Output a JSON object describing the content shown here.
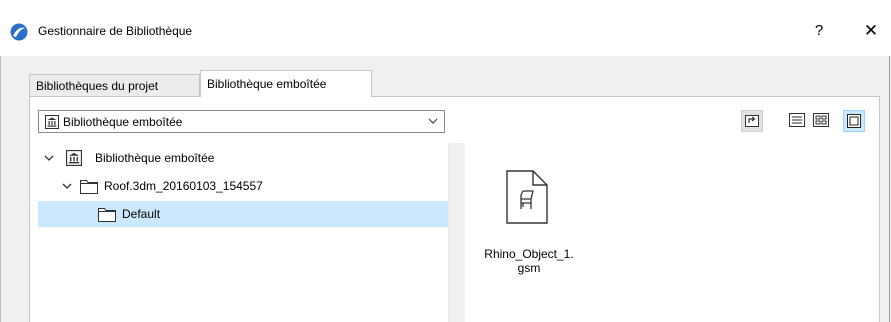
{
  "window": {
    "title": "Gestionnaire de Bibliothèque",
    "help_label": "?",
    "close_label": "✕"
  },
  "tabs": [
    {
      "label": "Bibliothèques du projet",
      "active": false
    },
    {
      "label": "Bibliothèque emboîtée",
      "active": true
    }
  ],
  "library_dropdown": {
    "selected": "Bibliothèque emboîtée"
  },
  "toolbar": {
    "buttons": [
      "parent-folder",
      "list-view",
      "small-icons-view",
      "large-icons-view"
    ],
    "active_view": "large-icons-view"
  },
  "tree": {
    "items": [
      {
        "label": "Bibliothèque emboîtée",
        "icon": "library-icon",
        "expanded": true,
        "selected": false
      },
      {
        "label": "Roof.3dm_20160103_154557",
        "icon": "folder-icon",
        "expanded": true,
        "selected": false
      },
      {
        "label": "Default",
        "icon": "folder-icon",
        "expanded": false,
        "selected": true
      }
    ]
  },
  "files": [
    {
      "name_line1": "Rhino_Object_1.",
      "name_line2": "gsm",
      "icon": "gsm-object-file-icon"
    }
  ],
  "colors": {
    "selection": "#cce8ff",
    "accent": "#0078d7"
  }
}
